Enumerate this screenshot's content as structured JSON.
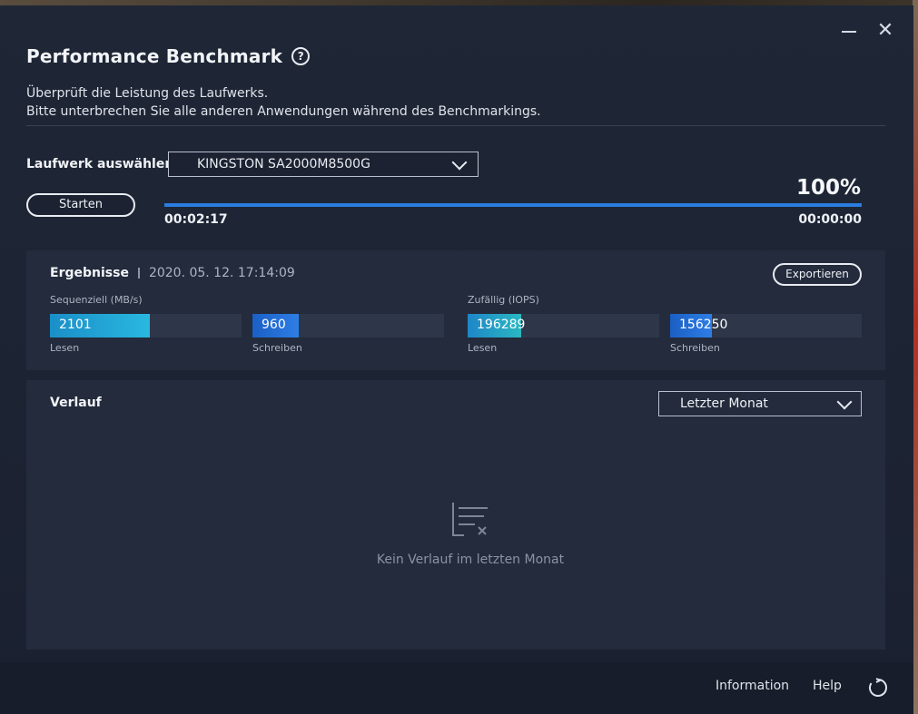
{
  "window": {
    "title": "Performance Benchmark",
    "minimize_icon": "minimize-icon",
    "close_icon": "close-icon",
    "help_glyph": "?"
  },
  "description": {
    "line1": "Überprüft die Leistung des Laufwerks.",
    "line2": "Bitte unterbrechen Sie alle anderen Anwendungen während des Benchmarkings."
  },
  "drive": {
    "label": "Laufwerk auswählen",
    "selected": "KINGSTON SA2000M8500G"
  },
  "benchmark": {
    "start_label": "Starten",
    "progress_percent": 100,
    "progress_text": "100%",
    "elapsed": "00:02:17",
    "remaining": "00:00:00"
  },
  "results": {
    "title": "Ergebnisse",
    "date": "2020. 05. 12. 17:14:09",
    "export_label": "Exportieren",
    "sequential": {
      "label": "Sequenziell (MB/s)",
      "read": {
        "value": "2101",
        "caption": "Lesen",
        "fill_fraction": 0.52
      },
      "write": {
        "value": "960",
        "caption": "Schreiben",
        "fill_fraction": 0.24
      }
    },
    "random": {
      "label": "Zufällig (IOPS)",
      "read": {
        "value": "196289",
        "caption": "Lesen",
        "fill_fraction": 0.28
      },
      "write": {
        "value": "156250",
        "caption": "Schreiben",
        "fill_fraction": 0.22
      }
    }
  },
  "history": {
    "title": "Verlauf",
    "period": "Letzter Monat",
    "empty_text": "Kein Verlauf im letzten Monat",
    "empty_icon": "empty-list-icon"
  },
  "footer": {
    "information_label": "Information",
    "help_label": "Help",
    "refresh_icon": "refresh-icon"
  },
  "colors": {
    "accent": "#2b7de0",
    "background": "#1f2737",
    "panel": "#232b3c"
  }
}
